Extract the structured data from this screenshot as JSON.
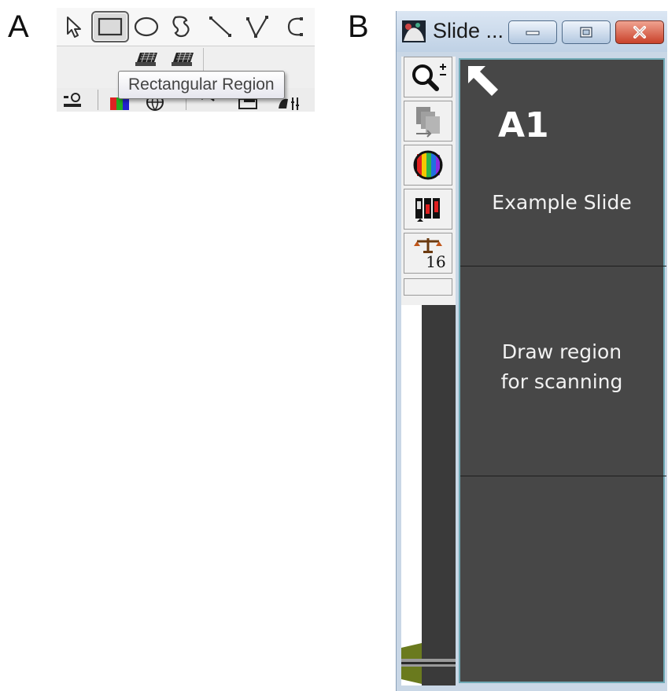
{
  "panels": {
    "a_label": "A",
    "b_label": "B"
  },
  "toolbar_a": {
    "tools": [
      {
        "name": "pointer-tool",
        "icon": "arrow-pointer-icon"
      },
      {
        "name": "rectangular-region-tool",
        "icon": "rectangle-icon",
        "selected": true
      },
      {
        "name": "ellipse-tool",
        "icon": "ellipse-icon"
      },
      {
        "name": "freehand-tool",
        "icon": "freehand-region-icon"
      },
      {
        "name": "line-tool",
        "icon": "line-icon"
      },
      {
        "name": "polyline-tool",
        "icon": "polyline-icon"
      },
      {
        "name": "arc-tool",
        "icon": "arc-icon"
      }
    ],
    "tooltip": "Rectangular Region"
  },
  "window_b": {
    "title": "Slide ...",
    "sidebar": {
      "zoom_icon": "magnifier-plus-minus-icon",
      "transfer_icon": "slide-transfer-icon",
      "color_icon": "color-wheel-icon",
      "channels_icon": "channel-bars-icon",
      "scale_icon": "balance-scale-icon",
      "scale_value": "16"
    },
    "viewer": {
      "slide_label": "A1",
      "slide_name": "Example Slide",
      "instruction_line1": "Draw region",
      "instruction_line2": "for scanning"
    }
  },
  "colors": {
    "viewer_bg": "#474747",
    "viewer_border": "#6fa9b5",
    "close_button": "#c9412a"
  }
}
